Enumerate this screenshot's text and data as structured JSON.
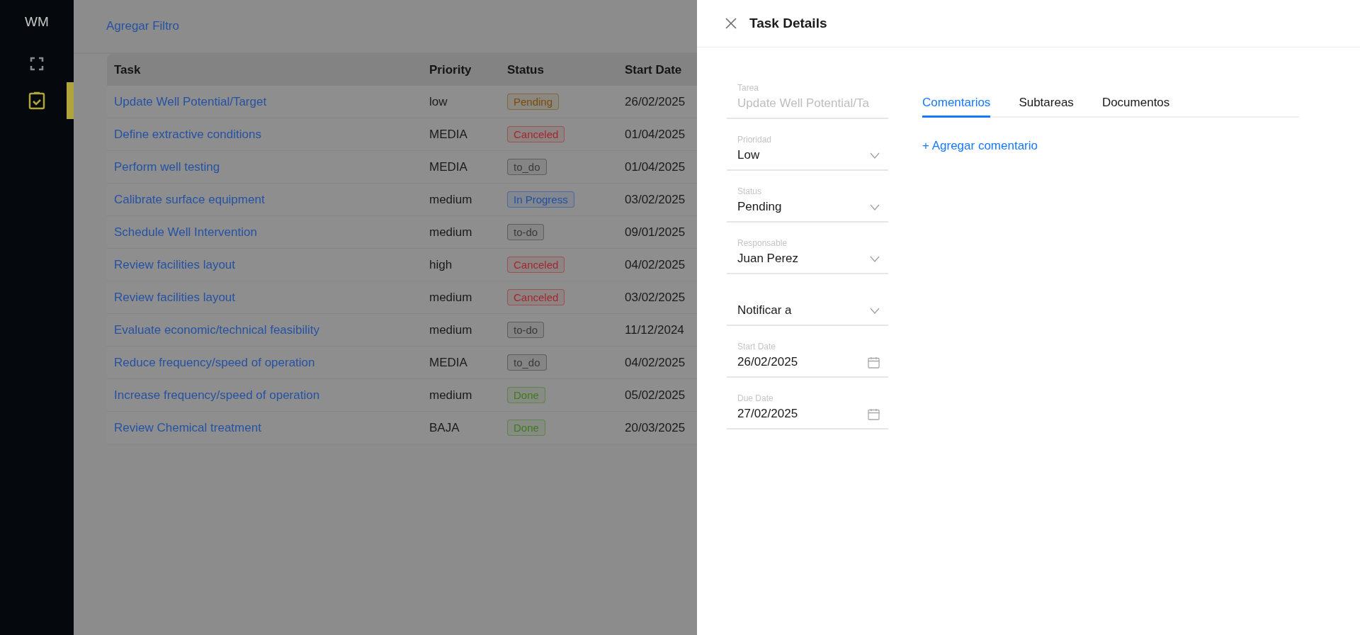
{
  "sidebar": {
    "logo": "WM",
    "items": [
      {
        "kind": "expand",
        "selected": false
      },
      {
        "kind": "clipboard",
        "selected": true
      }
    ]
  },
  "toolbar": {
    "filter_link": "Agregar Filtro"
  },
  "table": {
    "columns": [
      "Task",
      "Priority",
      "Status",
      "Start Date"
    ],
    "rows": [
      {
        "task": "Update Well Potential/Target",
        "priority": "low",
        "status": "Pending",
        "color": "#7a4c08",
        "start_date": "26/02/2025"
      },
      {
        "task": "Define extractive conditions",
        "priority": "MEDIA",
        "status": "Canceled",
        "color": "#a3262c",
        "start_date": "01/04/2025"
      },
      {
        "task": "Perform well testing",
        "priority": "MEDIA",
        "status": "to_do",
        "color": "#3a3a3a",
        "start_date": "01/04/2025"
      },
      {
        "task": "Calibrate surface equipment",
        "priority": "medium",
        "status": "In Progress",
        "color": "#1f4fa0",
        "start_date": "03/02/2025"
      },
      {
        "task": "Schedule Well Intervention",
        "priority": "medium",
        "status": "to-do",
        "color": "#3a3a3a",
        "start_date": "09/01/2025"
      },
      {
        "task": "Review facilities layout",
        "priority": "high",
        "status": "Canceled",
        "color": "#a3262c",
        "start_date": "04/02/2025"
      },
      {
        "task": "Review facilities layout",
        "priority": "medium",
        "status": "Canceled",
        "color": "#a3262c",
        "start_date": "03/02/2025"
      },
      {
        "task": "Evaluate economic/technical feasibility",
        "priority": "medium",
        "status": "to-do",
        "color": "#3a3a3a",
        "start_date": "11/12/2024"
      },
      {
        "task": "Reduce frequency/speed of operation",
        "priority": "MEDIA",
        "status": "to_do",
        "color": "#3a3a3a",
        "start_date": "04/02/2025"
      },
      {
        "task": "Increase frequency/speed of operation",
        "priority": "medium",
        "status": "Done",
        "color": "#3f7a1c",
        "start_date": "05/02/2025"
      },
      {
        "task": "Review Chemical treatment",
        "priority": "BAJA",
        "status": "Done",
        "color": "#3f7a1c",
        "start_date": "20/03/2025"
      }
    ]
  },
  "drawer": {
    "title": "Task Details",
    "fields": [
      {
        "kind": "text",
        "label": "Tarea",
        "value": "Update Well Potential/Ta",
        "disabled": true
      },
      {
        "kind": "select",
        "label": "Prioridad",
        "value": "Low",
        "disabled": false
      },
      {
        "kind": "select",
        "label": "Status",
        "value": "Pending",
        "disabled": false
      },
      {
        "kind": "select",
        "label": "Responsable",
        "value": "Juan Perez",
        "disabled": false
      },
      {
        "kind": "select",
        "value": "Notificar a",
        "disabled": false
      },
      {
        "kind": "date",
        "label": "Start Date",
        "value": "26/02/2025",
        "disabled": false
      },
      {
        "kind": "date",
        "label": "Due Date",
        "value": "27/02/2025",
        "disabled": false
      }
    ],
    "tabs": [
      {
        "label": "Comentarios",
        "selected": true
      },
      {
        "label": "Subtareas",
        "selected": false
      },
      {
        "label": "Documentos",
        "selected": false
      }
    ],
    "add_comment_link": "+ Agregar comentario"
  }
}
